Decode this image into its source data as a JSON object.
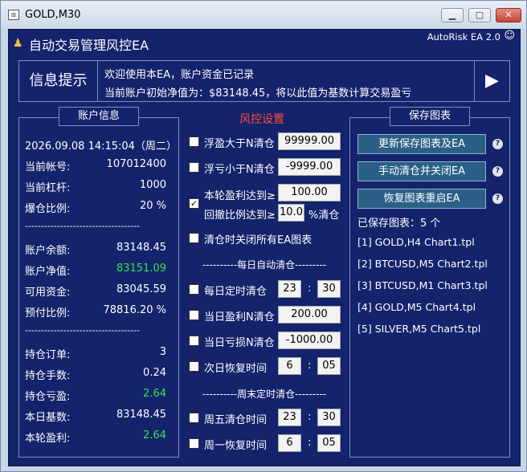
{
  "window": {
    "title": "GOLD,M30",
    "minimize": "▁",
    "maximize": "▢",
    "close": "✕"
  },
  "panel": {
    "title": "自动交易管理风控EA",
    "version": "AutoRisk EA 2.0",
    "smile": "☺"
  },
  "info": {
    "label": "信息提示",
    "line1": "欢迎使用本EA，账户资金已记录",
    "line2": "当前账户初始净值为：$83148.45，将以此值为基数计算交易盈亏",
    "play": "▶"
  },
  "account": {
    "title": "账户信息",
    "datetime": "2026.09.08 14:15:04（周二）",
    "rows1": [
      {
        "k": "当前帐号:",
        "v": "107012400"
      },
      {
        "k": "当前杠杆:",
        "v": "1000"
      },
      {
        "k": "爆仓比例:",
        "v": "20 %"
      }
    ],
    "sep": "------------------------------------",
    "rows2": [
      {
        "k": "账户余额:",
        "v": "83148.45"
      },
      {
        "k": "账户净值:",
        "v": "83151.09"
      },
      {
        "k": "可用资金:",
        "v": "83045.59"
      },
      {
        "k": "预付比例:",
        "v": "78816.20 %"
      }
    ],
    "rows3": [
      {
        "k": "持仓订单:",
        "v": "3"
      },
      {
        "k": "持仓手数:",
        "v": "0.24"
      },
      {
        "k": "持仓亏盈:",
        "v": "2.64"
      },
      {
        "k": "本日基数:",
        "v": "83148.45"
      },
      {
        "k": "本轮盈利:",
        "v": "2.64"
      }
    ],
    "green_color": "#33e64a"
  },
  "risk": {
    "title": "风控设置",
    "float_profit": {
      "label": "浮盈大于N清仓",
      "value": "99999.00",
      "checked": ""
    },
    "float_loss": {
      "label": "浮亏小于N清仓",
      "value": "-9999.00",
      "checked": ""
    },
    "round_profit": {
      "label": "本轮盈利达到≥",
      "value": "100.00",
      "checked": "✓"
    },
    "pullback": {
      "label": "回撤比例达到≥",
      "value": "10.0",
      "suffix": "%清仓"
    },
    "close_all": {
      "label": "清仓时关闭所有EA图表",
      "checked": ""
    },
    "daily_sep": "----------每日自动清仓---------",
    "daily_time": {
      "label": "每日定时清仓",
      "h": "23",
      "m": "30",
      "checked": ""
    },
    "daily_profit": {
      "label": "当日盈利N清仓",
      "value": "200.00",
      "checked": ""
    },
    "daily_loss": {
      "label": "当日亏损N清仓",
      "value": "-1000.00",
      "checked": ""
    },
    "next_resume": {
      "label": "次日恢复时间",
      "h": "6",
      "m": "05",
      "checked": ""
    },
    "weekend_sep": "----------周末定时清仓---------",
    "friday": {
      "label": "周五清仓时间",
      "h": "23",
      "m": "30",
      "checked": ""
    },
    "monday": {
      "label": "周一恢复时间",
      "h": "6",
      "m": "05",
      "checked": ""
    },
    "colon": ":"
  },
  "charts": {
    "title": "保存图表",
    "buttons": [
      "更新保存图表及EA",
      "手动清仓并关闭EA",
      "恢复图表重启EA"
    ],
    "help": "?",
    "count_label": "已保存图表：5 个",
    "items": [
      "[1] GOLD,H4 Chart1.tpl",
      "[2] BTCUSD,M5 Chart2.tpl",
      "[3] BTCUSD,M1 Chart3.tpl",
      "[4] GOLD,M5 Chart4.tpl",
      "[5] SILVER,M5 Chart5.tpl"
    ]
  }
}
